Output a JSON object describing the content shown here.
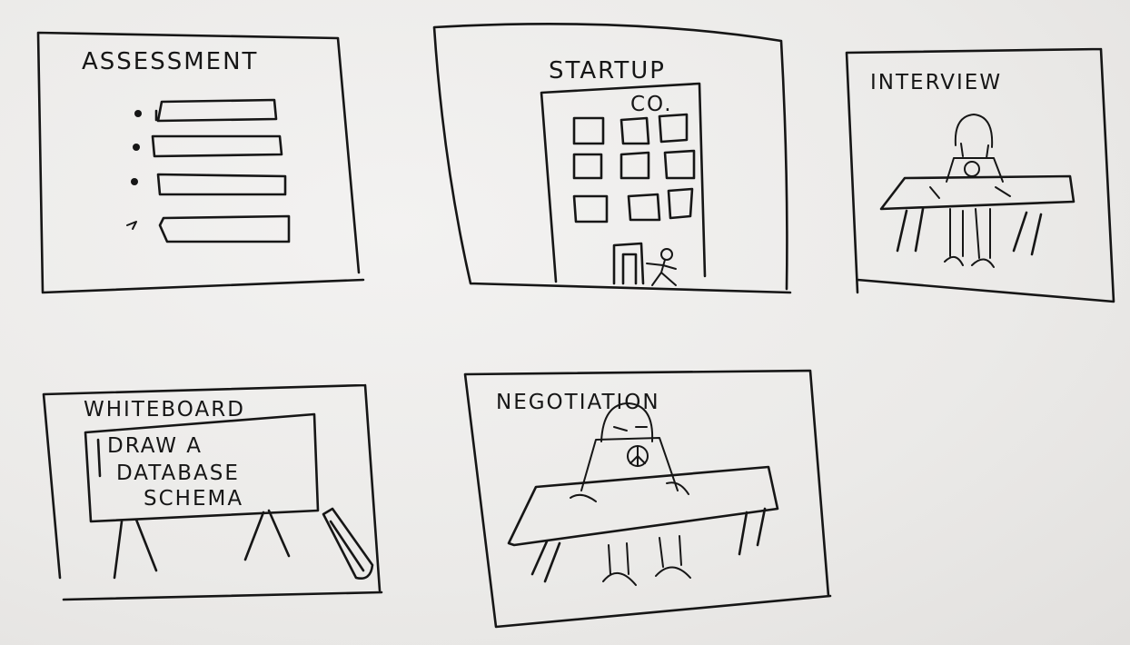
{
  "panels": {
    "assessment": {
      "title": "ASSESSMENT"
    },
    "startup": {
      "title": "STARTUP",
      "subtitle": "CO."
    },
    "interview": {
      "title": "INTERVIEW"
    },
    "whiteboard": {
      "title": "WHITEBOARD",
      "lines": [
        "DRAW A",
        "DATABASE",
        "SCHEMA"
      ]
    },
    "negotiation": {
      "title": "NEGOTIATION"
    }
  },
  "colors": {
    "ink": "#161616",
    "paper": "#eeedec"
  }
}
